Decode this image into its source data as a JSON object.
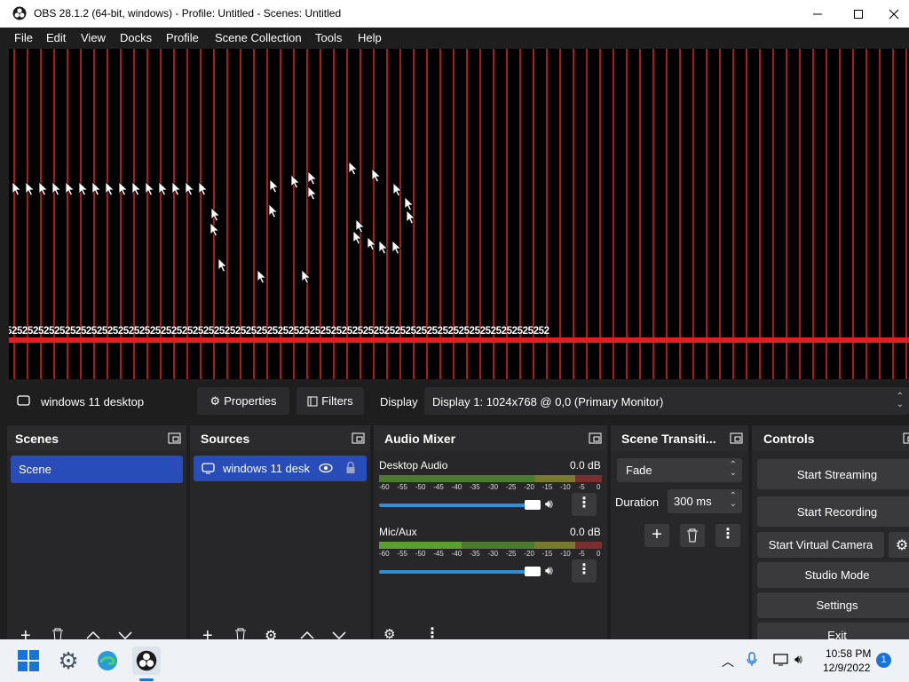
{
  "window": {
    "title": "OBS 28.1.2 (64-bit, windows) - Profile: Untitled - Scenes: Untitled"
  },
  "menu": [
    "File",
    "Edit",
    "View",
    "Docks",
    "Profile",
    "Scene Collection",
    "Tools",
    "Help"
  ],
  "preview": {
    "ruler_text": "525252525252525252525252525252525252525252525252525252525252525252525252525252525252525252525252525252"
  },
  "source_bar": {
    "source_name": "windows 11 desktop",
    "properties_label": "Properties",
    "filters_label": "Filters",
    "display_label": "Display",
    "display_value": "Display 1: 1024x768 @ 0,0 (Primary Monitor)"
  },
  "scenes": {
    "title": "Scenes",
    "items": [
      "Scene"
    ]
  },
  "sources": {
    "title": "Sources",
    "items": [
      "windows 11 desk"
    ]
  },
  "audio_mixer": {
    "title": "Audio Mixer",
    "ticks": [
      "-60",
      "-55",
      "-50",
      "-45",
      "-40",
      "-35",
      "-30",
      "-25",
      "-20",
      "-15",
      "-10",
      "-5",
      "0"
    ],
    "channels": [
      {
        "name": "Desktop Audio",
        "db": "0.0 dB"
      },
      {
        "name": "Mic/Aux",
        "db": "0.0 dB"
      }
    ]
  },
  "transitions": {
    "title": "Scene Transiti...",
    "selected": "Fade",
    "duration_label": "Duration",
    "duration_value": "300 ms"
  },
  "controls": {
    "title": "Controls",
    "start_streaming": "Start Streaming",
    "start_recording": "Start Recording",
    "start_virtual_camera": "Start Virtual Camera",
    "studio_mode": "Studio Mode",
    "settings": "Settings",
    "exit": "Exit"
  },
  "taskbar": {
    "time": "10:58 PM",
    "date": "12/9/2022",
    "notifications": "1"
  },
  "colors": {
    "accent": "#284cb8",
    "stripe": "#d9201c",
    "slider": "#2d8ed9"
  }
}
